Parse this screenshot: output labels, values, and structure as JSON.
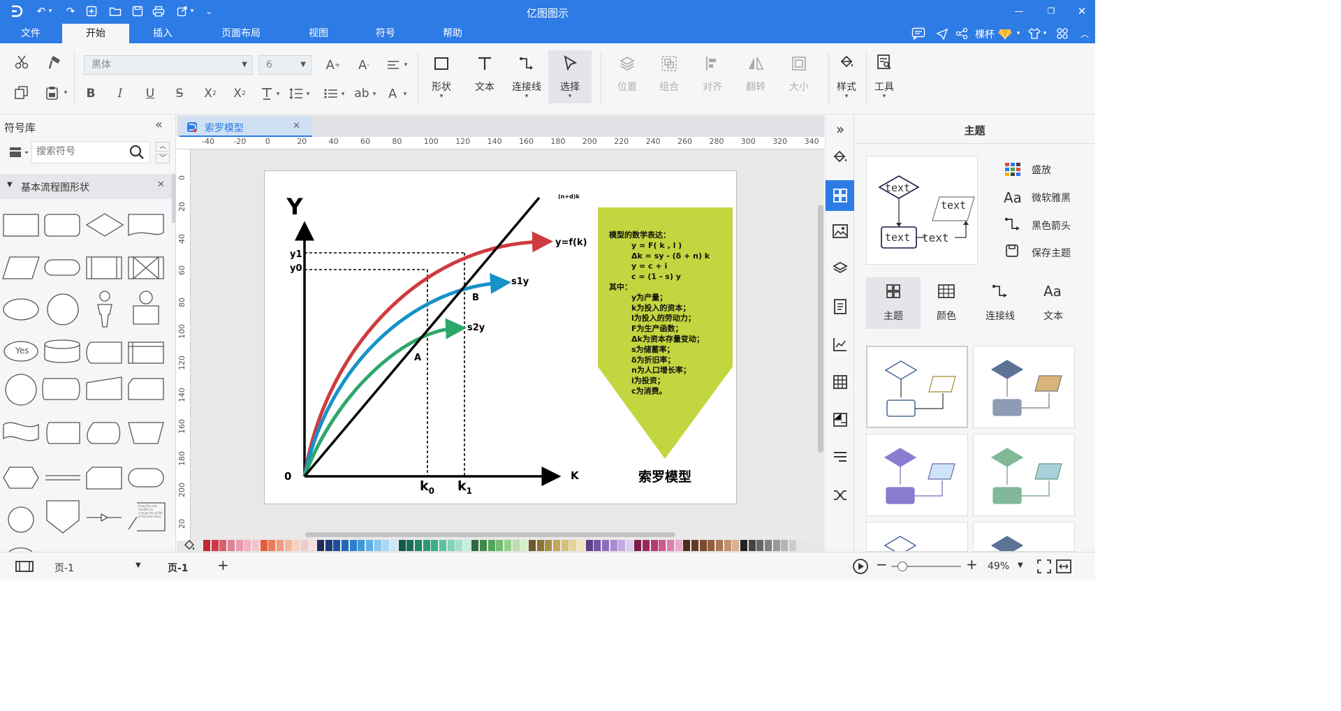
{
  "app": {
    "title": "亿图图示"
  },
  "menu": {
    "tabs": [
      "文件",
      "开始",
      "插入",
      "页面布局",
      "视图",
      "符号",
      "帮助"
    ],
    "active": "开始",
    "user": "棵杯"
  },
  "toolbar": {
    "font_name": "黑体",
    "font_size": "6",
    "big_buttons": [
      {
        "label": "形状",
        "icon": "rectangle-icon",
        "enabled": true
      },
      {
        "label": "文本",
        "icon": "text-t-icon",
        "enabled": true
      },
      {
        "label": "连接线",
        "icon": "connector-icon",
        "enabled": true
      },
      {
        "label": "选择",
        "icon": "pointer-icon",
        "enabled": true
      }
    ],
    "arrange_buttons": [
      {
        "label": "位置",
        "icon": "layers-icon"
      },
      {
        "label": "组合",
        "icon": "group-icon"
      },
      {
        "label": "对齐",
        "icon": "align-icon"
      },
      {
        "label": "翻转",
        "icon": "flip-icon"
      },
      {
        "label": "大小",
        "icon": "size-icon"
      }
    ],
    "style_label": "样式",
    "tools_label": "工具"
  },
  "library": {
    "title": "符号库",
    "search_placeholder": "搜索符号",
    "category": "基本流程图形状",
    "yes_label": "Yes",
    "note_text": "Drag the side handles to change the width of the text block."
  },
  "document": {
    "tab_title": "索罗模型",
    "ruler_x": [
      "-40",
      "-20",
      "0",
      "20",
      "40",
      "60",
      "80",
      "100",
      "120",
      "140",
      "160",
      "180",
      "200",
      "220",
      "240",
      "260",
      "280",
      "300",
      "320",
      "340"
    ],
    "ruler_y": [
      "0",
      "20",
      "40",
      "60",
      "80",
      "100",
      "120",
      "140",
      "160",
      "180",
      "200",
      "20"
    ]
  },
  "chart_data": {
    "type": "line",
    "labels": {
      "y_axis": "Y",
      "x_axis": "K",
      "origin": "0",
      "line": "(n+d)k",
      "f": "y=f(k)",
      "s1": "s1y",
      "s2": "s2y",
      "a": "A",
      "b": "B",
      "y1": "y1",
      "y0": "y0",
      "k0": "k",
      "k0_sub": "0",
      "k1": "k",
      "k1_sub": "1"
    },
    "series": [
      {
        "name": "y=f(k)",
        "color": "#cf3b3f"
      },
      {
        "name": "s1y",
        "color": "#1692c9"
      },
      {
        "name": "s2y",
        "color": "#2ea76a"
      },
      {
        "name": "(n+d)k",
        "color": "#000000"
      }
    ]
  },
  "annotation": {
    "color": "#c2d63f",
    "lines": [
      "模型的数学表达：",
      "y = F( k , l )",
      "Δk = sy -  (δ + n)  k",
      "y = c + i",
      "c =  (1 - s)  y",
      "其中：",
      "y为产量；",
      "k为投入的资本；",
      "l为投入的劳动力；",
      "F为生产函数；",
      "Δk为资本存量变动；",
      "s为储蓄率；",
      "δ为折旧率；",
      "n为人口增长率；",
      "i为投资；",
      "c为消费。"
    ],
    "title": "索罗模型"
  },
  "right_panel": {
    "title": "主题",
    "preview_texts": [
      "text",
      "text",
      "text",
      "text"
    ],
    "options": [
      {
        "label": "盛放",
        "icon": "palette-grid-icon"
      },
      {
        "label": "微软雅黑",
        "icon": "font-aa-icon"
      },
      {
        "label": "黑色箭头",
        "icon": "connector-arrow-icon"
      },
      {
        "label": "保存主题",
        "icon": "save-icon"
      }
    ],
    "tabs": [
      {
        "label": "主题",
        "icon": "theme-grid-icon"
      },
      {
        "label": "颜色",
        "icon": "color-grid-icon"
      },
      {
        "label": "连接线",
        "icon": "connector-icon"
      },
      {
        "label": "文本",
        "icon": "text-aa-icon"
      }
    ],
    "theme_colors": [
      {
        "a": "#ffffff",
        "b": "#ffffff",
        "line": "#333333",
        "shape": "#2a4d80"
      },
      {
        "a": "#5c7396",
        "b": "#d9b47a",
        "line": "#777777",
        "shape": "#5c7396"
      },
      {
        "a": "#d0c8f0",
        "b": "#cfe3f8",
        "line": "#6c6cb0",
        "shape": "#8b7bd0"
      },
      {
        "a": "#9ed2c0",
        "b": "#a9d1dc",
        "line": "#6a9a7a",
        "shape": "#80b898"
      }
    ]
  },
  "status": {
    "page_label": "页-1",
    "active_page": "页-1",
    "zoom": "49%"
  },
  "palette": [
    "#c1272d",
    "#d0374b",
    "#d95f6c",
    "#e08190",
    "#e89ab0",
    "#f0b3c0",
    "#f3c2cc",
    "#e05e3c",
    "#ea7b5a",
    "#f39a7b",
    "#f7b59b",
    "#fbd0bd",
    "#f4c9c9",
    "#f8dede",
    "#1f2a5c",
    "#203a78",
    "#1d4f9e",
    "#2366b6",
    "#2b7fcd",
    "#3d99dc",
    "#5cb0e6",
    "#86c6ee",
    "#aad8f3",
    "#cae7f8",
    "#145a4b",
    "#1a6d57",
    "#208466",
    "#2a9a74",
    "#3ab08a",
    "#5bc2a0",
    "#81d2b7",
    "#a5e0ca",
    "#c7eddc",
    "#2d6a3d",
    "#3f8a4c",
    "#52a65a",
    "#72bb6f",
    "#95ce8b",
    "#b9dfab",
    "#d6ecc8",
    "#6b5b2a",
    "#8a7437",
    "#a98f47",
    "#c2a85b",
    "#d6bf78",
    "#e5d299",
    "#f0e3bb",
    "#5a3e86",
    "#7454a3",
    "#8d6cc0",
    "#a989d2",
    "#c3a9e1",
    "#dbcbee",
    "#7a1e48",
    "#962a5b",
    "#b33a71",
    "#cc5a8d",
    "#dd80aa",
    "#eca8c6",
    "#4a2b1a",
    "#633a24",
    "#7c4a2f",
    "#955d3d",
    "#ae7552",
    "#c5916f",
    "#d9b092",
    "#222222",
    "#444444",
    "#666666",
    "#808080",
    "#999999",
    "#b3b3b3",
    "#cccccc",
    "#e6e6e6"
  ]
}
